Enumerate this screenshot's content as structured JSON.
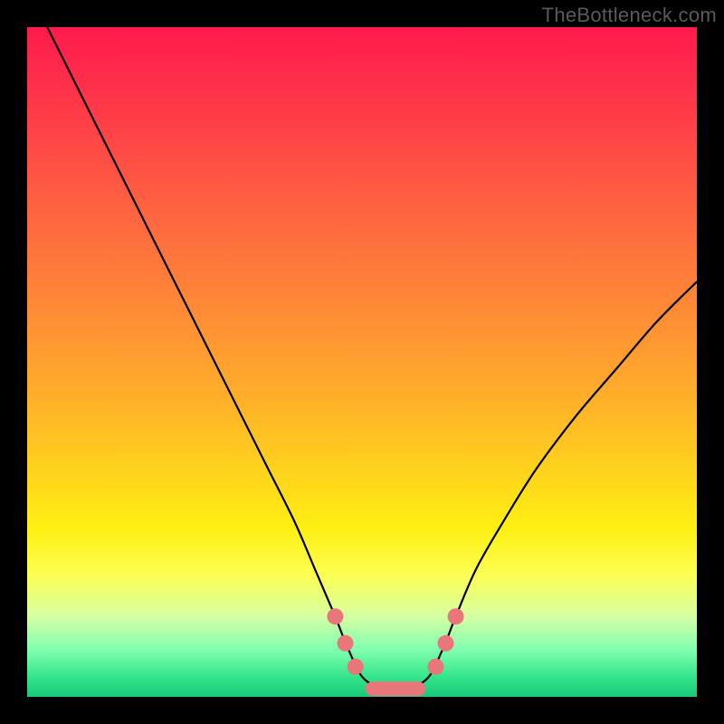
{
  "watermark": "TheBottleneck.com",
  "colors": {
    "frame": "#000000",
    "curve": "#000000",
    "marker": "#e9767a",
    "gradient_stops": [
      "#ff1a4d",
      "#ff4a46",
      "#ff8a36",
      "#ffd21d",
      "#fcff55",
      "#7fffb0",
      "#18c879"
    ]
  },
  "chart_data": {
    "type": "line",
    "title": "",
    "xlabel": "",
    "ylabel": "",
    "xlim": [
      0,
      100
    ],
    "ylim": [
      0,
      100
    ],
    "note": "Values are approximate, read from pixel positions of the curve; y=0 at bottom (green), y=100 at top (red).",
    "series": [
      {
        "name": "curve",
        "x": [
          3,
          8,
          12,
          16,
          20,
          24,
          28,
          32,
          36,
          40,
          43,
          46,
          48,
          50.5,
          55,
          59.5,
          62,
          64,
          67,
          71,
          76,
          82,
          88,
          94,
          100
        ],
        "y": [
          100,
          90,
          82,
          74,
          66,
          58,
          50,
          42,
          34,
          26,
          19,
          12,
          7,
          2.5,
          1,
          2.5,
          7,
          12,
          19,
          26,
          34,
          42,
          49,
          56,
          62
        ]
      }
    ],
    "markers": {
      "note": "Highlighted points/pill near the valley of the curve.",
      "points": [
        {
          "x": 46,
          "y": 12
        },
        {
          "x": 47.5,
          "y": 8
        },
        {
          "x": 49,
          "y": 4.5
        },
        {
          "x": 61,
          "y": 4.5
        },
        {
          "x": 62.5,
          "y": 8
        },
        {
          "x": 64,
          "y": 12
        }
      ],
      "pill": {
        "x_start": 50.5,
        "x_end": 59.5,
        "y": 1.2
      }
    }
  }
}
